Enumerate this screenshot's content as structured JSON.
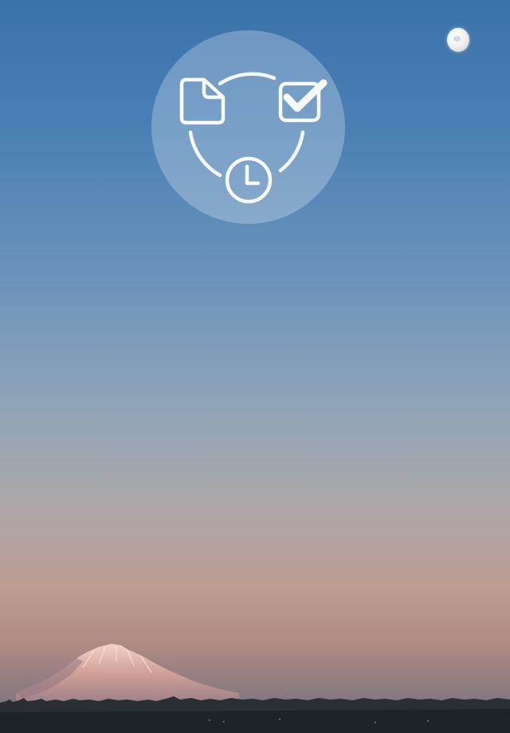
{
  "screen": {
    "background": "sky-gradient",
    "colors": {
      "sky_top": "#3a72aa",
      "sky_middle": "#8fa4b8",
      "sky_horizon": "#bd9d94",
      "treeline": "#23282d",
      "mountain": "#c99a92"
    }
  },
  "logo": {
    "icons": [
      "document-icon",
      "checkbox-checked-icon",
      "clock-icon"
    ]
  },
  "scenery": {
    "elements": [
      "moon",
      "snow-capped-mountain",
      "treeline"
    ]
  }
}
